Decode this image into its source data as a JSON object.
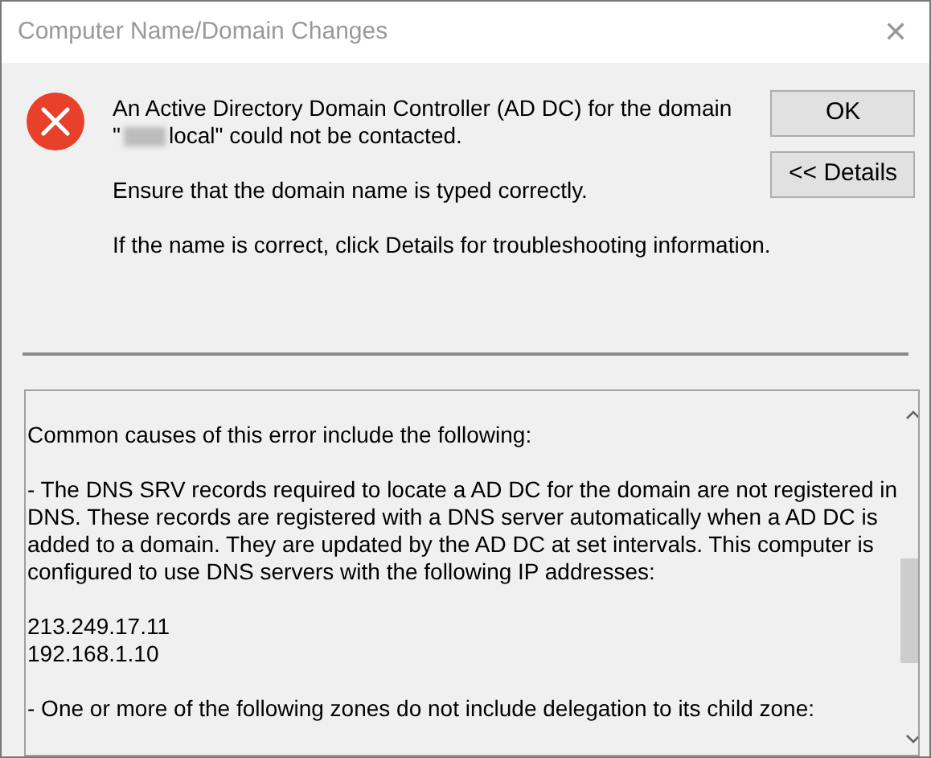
{
  "window": {
    "title": "Computer Name/Domain Changes",
    "close": "✕"
  },
  "message": {
    "line_1": "An Active Directory Domain Controller (AD DC) for the domain",
    "line_2_start": "\"",
    "line_2_end": "local\" could not be contacted.",
    "hint_1": "Ensure that the domain name is typed correctly.",
    "hint_2": "If the name is correct, click Details for troubleshooting information."
  },
  "buttons": [
    {
      "label": "OK"
    },
    {
      "label": "<< Details"
    }
  ],
  "details": {
    "paragraphs": [
      {
        "lines": [
          "Common causes of this error include the following:"
        ]
      },
      {
        "lines": [
          "- The DNS SRV records required to locate a AD DC for the domain are not registered in",
          "DNS. These records are registered with a DNS server automatically when a AD DC is",
          "added to a domain. They are updated by the AD DC at set intervals. This computer is",
          "configured to use DNS servers with the following IP addresses:"
        ]
      },
      {
        "lines": [
          "213.249.17.11",
          "192.168.1.10"
        ]
      },
      {
        "lines": [
          "- One or more of the following zones do not include delegation to its child zone:"
        ]
      }
    ]
  }
}
